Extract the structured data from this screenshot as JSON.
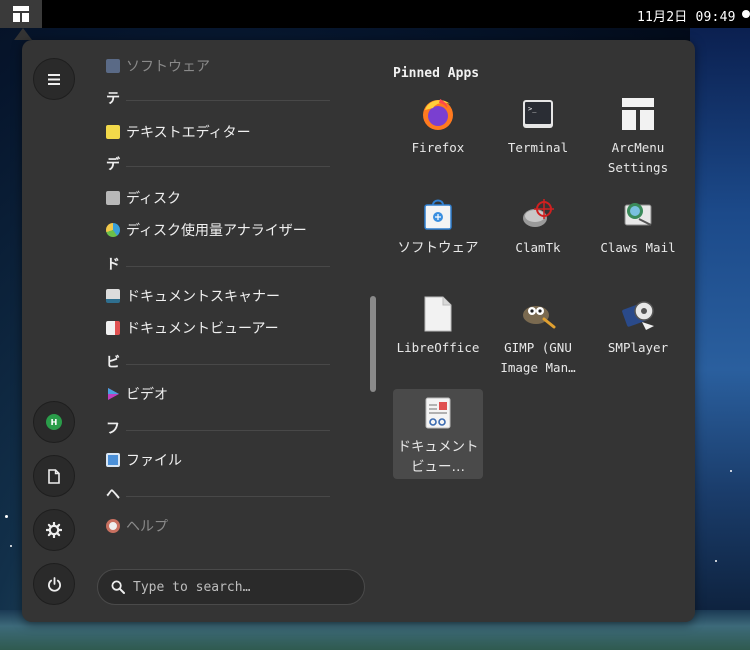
{
  "top_panel": {
    "clock": "11月2日 09:49"
  },
  "sidebar": {
    "buttons": [
      {
        "icon": "hamburger-menu-icon"
      },
      {
        "icon": "avatar"
      },
      {
        "icon": "document-icon"
      },
      {
        "icon": "gear-icon"
      },
      {
        "icon": "power-icon"
      }
    ],
    "avatar_letter": "H"
  },
  "list": {
    "items": [
      {
        "kind": "app",
        "label": "ソフトウェア",
        "faded": true,
        "color": "#6a7a9a"
      },
      {
        "kind": "section",
        "letter": "テ"
      },
      {
        "kind": "app",
        "label": "テキストエディター",
        "color": "#f2d94a"
      },
      {
        "kind": "section",
        "letter": "デ"
      },
      {
        "kind": "app",
        "label": "ディスク",
        "color": "#b0b0b0"
      },
      {
        "kind": "app",
        "label": "ディスク使用量アナライザー",
        "color": "#3aa0d8"
      },
      {
        "kind": "section",
        "letter": "ド"
      },
      {
        "kind": "app",
        "label": "ドキュメントスキャナー",
        "color": "#dcdcdc"
      },
      {
        "kind": "app",
        "label": "ドキュメントビューアー",
        "color": "#e05050"
      },
      {
        "kind": "section",
        "letter": "ビ"
      },
      {
        "kind": "app",
        "label": "ビデオ",
        "color": "#c040c0"
      },
      {
        "kind": "section",
        "letter": "フ"
      },
      {
        "kind": "app",
        "label": "ファイル",
        "color": "#4a90d9"
      },
      {
        "kind": "section",
        "letter": "ヘ"
      },
      {
        "kind": "app",
        "label": "ヘルプ",
        "faded": true,
        "color": "#d07060"
      }
    ]
  },
  "search": {
    "placeholder": "Type to search…"
  },
  "pinned": {
    "title": "Pinned Apps",
    "apps": [
      {
        "name": "Firefox",
        "icon": "firefox-icon"
      },
      {
        "name": "Terminal",
        "icon": "terminal-icon"
      },
      {
        "name": "ArcMenu Settings",
        "icon": "arcmenu-settings-icon"
      },
      {
        "name": "ソフトウェア",
        "icon": "software-bag-icon"
      },
      {
        "name": "ClamTk",
        "icon": "clamtk-icon"
      },
      {
        "name": "Claws Mail",
        "icon": "claws-mail-icon"
      },
      {
        "name": "LibreOffice",
        "icon": "libreoffice-icon"
      },
      {
        "name": "GIMP (GNU Image Man…",
        "icon": "gimp-icon"
      },
      {
        "name": "SMPlayer",
        "icon": "smplayer-icon"
      },
      {
        "name": "ドキュメントビュー…",
        "icon": "document-viewer-icon",
        "selected": true
      }
    ]
  },
  "colors": {
    "menu_bg": "#343434",
    "selected_bg": "#4a4a4a",
    "avatar_green": "#2a9d4a"
  }
}
